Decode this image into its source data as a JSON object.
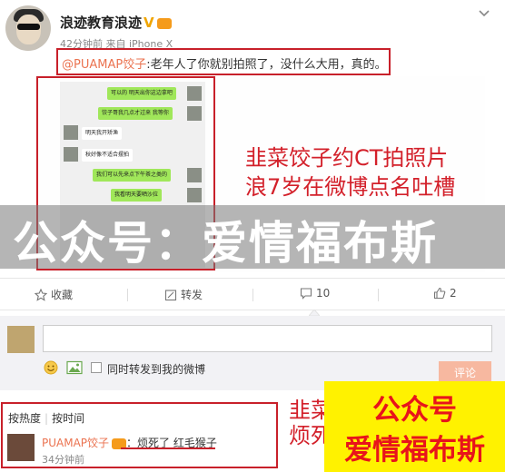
{
  "post": {
    "author": "浪迹教育浪迹",
    "verified_badge": "V",
    "meta": "42分钟前 来自 iPhone X",
    "mention": "@PUAMAP饺子",
    "text": ":老年人了你就别拍照了，没什么大用，真的。"
  },
  "image": {
    "chat_messages": [
      {
        "side": "right",
        "text": "可以的 明天出你这边拿吧"
      },
      {
        "side": "right",
        "text": "饺子哥我几点才过来 我等你"
      },
      {
        "side": "left",
        "text": "明天我开矫渔"
      },
      {
        "side": "left",
        "text": "秋好像不适合摆拍"
      },
      {
        "side": "right",
        "text": "我们可以先来点下午茶之类的"
      },
      {
        "side": "right",
        "text": "我看明天要晒沙拉"
      }
    ],
    "caption_line1": "韭菜饺子约CT拍照片",
    "caption_line2": "浪7岁在微博点名吐槽",
    "watermark": "公众号：爱情福布斯"
  },
  "actions": {
    "favorite": "收藏",
    "repost": "转发",
    "comment": "10",
    "like": "2"
  },
  "compose": {
    "checkbox_label": "同时转发到我的微博",
    "submit": "评论"
  },
  "comments": {
    "sort_hot": "按热度",
    "sort_time": "按时间",
    "items": [
      {
        "name": "PUAMAP饺子",
        "text": "：烦死了 红毛猴子",
        "time": "34分钟前"
      }
    ],
    "overlay_partial_line1": "韭菜",
    "overlay_partial_line2": "烦死"
  },
  "promo": {
    "line1": "公众号",
    "line2": "爱情福布斯"
  },
  "colors": {
    "accent_red": "#c8202a",
    "mention_orange": "#eb7350",
    "promo_bg": "#fff200",
    "promo_text": "#e8141b",
    "chat_green": "#a0e75a"
  }
}
